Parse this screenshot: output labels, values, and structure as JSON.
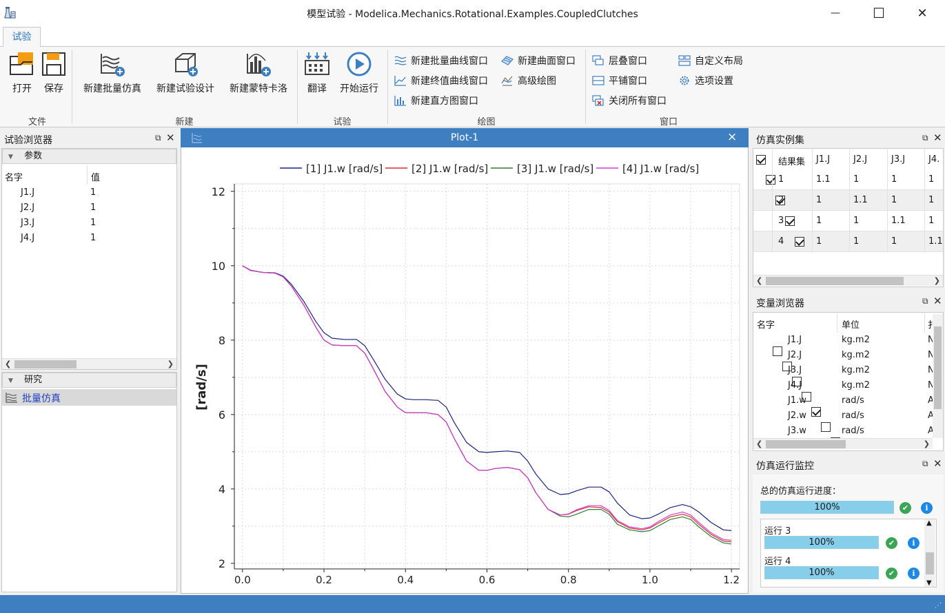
{
  "window": {
    "title": "模型试验 - Modelica.Mechanics.Rotational.Examples.CoupledClutches",
    "minimize": "—",
    "maximize": "☐",
    "close": "✕"
  },
  "ribbon": {
    "tab": "试验",
    "groups": {
      "file": "文件",
      "new": "新建",
      "experiment": "试验",
      "plot": "绘图",
      "window": "窗口"
    },
    "buttons": {
      "open": "打开",
      "save": "保存",
      "new_batch_sim": "新建批量仿真",
      "new_experiment_design": "新建试验设计",
      "new_monte_carlo": "新建蒙特卡洛",
      "translate": "翻译",
      "start_run": "开始运行",
      "new_batch_curve": "新建批量曲线窗口",
      "new_final_value_curve": "新建终值曲线窗口",
      "new_histogram": "新建直方图窗口",
      "new_surface": "新建曲面窗口",
      "advanced_plot": "高级绘图",
      "cascade": "层叠窗口",
      "tile": "平铺窗口",
      "close_all": "关闭所有窗口",
      "custom_layout": "自定义布局",
      "options": "选项设置"
    }
  },
  "experiment_browser": {
    "title": "试验浏览器",
    "params_section": "参数",
    "col_name": "名字",
    "col_value": "值",
    "params": [
      {
        "name": "J1.J",
        "value": "1"
      },
      {
        "name": "J2.J",
        "value": "1"
      },
      {
        "name": "J3.J",
        "value": "1"
      },
      {
        "name": "J4.J",
        "value": "1"
      }
    ],
    "study_section": "研究",
    "study_item": "批量仿真"
  },
  "plot": {
    "title": "Plot-1",
    "close": "×"
  },
  "chart_data": {
    "type": "line",
    "title": "",
    "xlabel": "",
    "ylabel": "[rad/s]",
    "xlim": [
      -0.02,
      1.22
    ],
    "ylim": [
      1.85,
      12.2
    ],
    "xticks": [
      0.0,
      0.2,
      0.4,
      0.6,
      0.8,
      1.0,
      1.2
    ],
    "yticks": [
      2,
      4,
      6,
      8,
      10,
      12
    ],
    "grid": true,
    "legend_position": "top",
    "x": [
      0.0,
      0.02,
      0.05,
      0.08,
      0.1,
      0.12,
      0.15,
      0.18,
      0.2,
      0.22,
      0.25,
      0.28,
      0.3,
      0.32,
      0.35,
      0.38,
      0.4,
      0.42,
      0.45,
      0.48,
      0.5,
      0.52,
      0.55,
      0.58,
      0.6,
      0.62,
      0.65,
      0.68,
      0.7,
      0.72,
      0.75,
      0.78,
      0.8,
      0.82,
      0.85,
      0.88,
      0.9,
      0.92,
      0.95,
      0.98,
      1.0,
      1.02,
      1.05,
      1.08,
      1.1,
      1.12,
      1.15,
      1.18,
      1.2
    ],
    "series": [
      {
        "name": "[1] J1.w [rad/s]",
        "color": "#1a237e",
        "values": [
          10.0,
          9.88,
          9.82,
          9.81,
          9.72,
          9.5,
          9.05,
          8.5,
          8.2,
          8.05,
          8.02,
          8.02,
          7.85,
          7.5,
          6.95,
          6.55,
          6.42,
          6.4,
          6.4,
          6.38,
          6.2,
          5.78,
          5.25,
          5.0,
          4.98,
          5.0,
          5.02,
          4.98,
          4.75,
          4.4,
          4.0,
          3.85,
          3.87,
          3.95,
          4.05,
          4.05,
          3.92,
          3.62,
          3.3,
          3.2,
          3.22,
          3.32,
          3.5,
          3.58,
          3.52,
          3.38,
          3.1,
          2.9,
          2.88
        ]
      },
      {
        "name": "[2] J1.w [rad/s]",
        "color": "#d32f2f",
        "values": [
          10.0,
          9.87,
          9.82,
          9.8,
          9.7,
          9.45,
          8.95,
          8.35,
          8.0,
          7.87,
          7.85,
          7.85,
          7.65,
          7.25,
          6.62,
          6.2,
          6.05,
          6.05,
          6.05,
          6.0,
          5.8,
          5.35,
          4.75,
          4.5,
          4.5,
          4.55,
          4.58,
          4.52,
          4.3,
          3.9,
          3.45,
          3.3,
          3.32,
          3.42,
          3.52,
          3.5,
          3.38,
          3.12,
          2.95,
          2.9,
          2.95,
          3.08,
          3.25,
          3.32,
          3.25,
          3.05,
          2.78,
          2.6,
          2.58
        ]
      },
      {
        "name": "[3] J1.w [rad/s]",
        "color": "#2e7d32",
        "values": [
          10.0,
          9.87,
          9.82,
          9.8,
          9.7,
          9.45,
          8.95,
          8.35,
          8.0,
          7.87,
          7.85,
          7.85,
          7.65,
          7.25,
          6.62,
          6.2,
          6.05,
          6.05,
          6.05,
          6.0,
          5.8,
          5.35,
          4.75,
          4.5,
          4.5,
          4.55,
          4.58,
          4.52,
          4.3,
          3.9,
          3.45,
          3.27,
          3.25,
          3.32,
          3.45,
          3.45,
          3.32,
          3.05,
          2.9,
          2.85,
          2.88,
          3.0,
          3.18,
          3.25,
          3.18,
          2.98,
          2.72,
          2.55,
          2.52
        ]
      },
      {
        "name": "[4] J1.w [rad/s]",
        "color": "#d63cd6",
        "values": [
          10.0,
          9.87,
          9.82,
          9.8,
          9.7,
          9.45,
          8.95,
          8.35,
          8.0,
          7.87,
          7.85,
          7.85,
          7.65,
          7.25,
          6.62,
          6.2,
          6.05,
          6.05,
          6.05,
          6.0,
          5.8,
          5.35,
          4.75,
          4.5,
          4.5,
          4.55,
          4.58,
          4.52,
          4.3,
          3.9,
          3.45,
          3.3,
          3.33,
          3.44,
          3.55,
          3.55,
          3.42,
          3.15,
          2.98,
          2.93,
          2.98,
          3.12,
          3.3,
          3.38,
          3.3,
          3.1,
          2.82,
          2.64,
          2.62
        ]
      }
    ]
  },
  "sim_instances": {
    "title": "仿真实例集",
    "columns": [
      "结果集",
      "J1.J",
      "J2.J",
      "J3.J",
      "J4."
    ],
    "rows": [
      {
        "checked": true,
        "cells": [
          "1",
          "1.1",
          "1",
          "1",
          "1"
        ]
      },
      {
        "checked": true,
        "cells": [
          "2",
          "1",
          "1.1",
          "1",
          "1"
        ]
      },
      {
        "checked": true,
        "cells": [
          "3",
          "1",
          "1",
          "1.1",
          "1"
        ]
      },
      {
        "checked": true,
        "cells": [
          "4",
          "1",
          "1",
          "1",
          "1.1"
        ]
      }
    ]
  },
  "var_browser": {
    "title": "变量浏览器",
    "col_name": "名字",
    "col_unit": "单位",
    "col_extra": "扌",
    "rows": [
      {
        "checked": false,
        "name": "J1.J",
        "unit": "kg.m2",
        "extra": "N"
      },
      {
        "checked": false,
        "name": "J2.J",
        "unit": "kg.m2",
        "extra": "N"
      },
      {
        "checked": false,
        "name": "J3.J",
        "unit": "kg.m2",
        "extra": "N"
      },
      {
        "checked": false,
        "name": "J4.J",
        "unit": "kg.m2",
        "extra": "N"
      },
      {
        "checked": true,
        "name": "J1.w",
        "unit": "rad/s",
        "extra": "A"
      },
      {
        "checked": false,
        "name": "J2.w",
        "unit": "rad/s",
        "extra": "A"
      },
      {
        "checked": false,
        "name": "J3.w",
        "unit": "rad/s",
        "extra": "A"
      }
    ]
  },
  "run_monitor": {
    "title": "仿真运行监控",
    "total_label": "总的仿真运行进度：",
    "total_progress": 1.0,
    "total_text": "100%",
    "runs": [
      {
        "label": "运行 3",
        "progress": 1.0,
        "text": "100%"
      },
      {
        "label": "运行 4",
        "progress": 1.0,
        "text": "100%"
      }
    ]
  }
}
